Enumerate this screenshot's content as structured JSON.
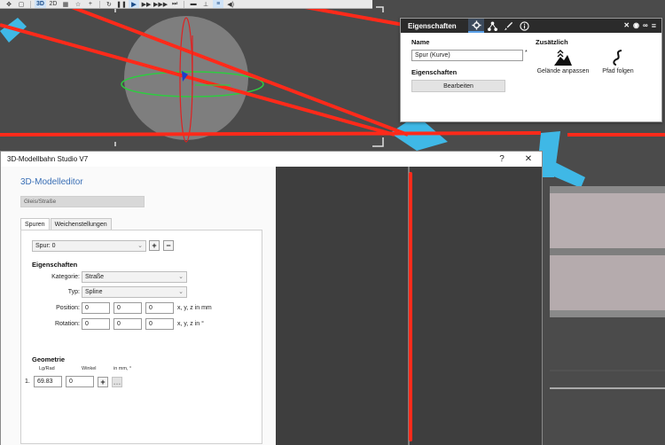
{
  "toolbar": {
    "items": [
      "3D",
      "2D"
    ]
  },
  "properties": {
    "title": "Eigenschaften",
    "name_label": "Name",
    "name_value": "Spur (Kurve)",
    "name_marker": "*",
    "props_label": "Eigenschaften",
    "edit_button": "Bearbeiten",
    "extra_label": "Zusätzlich",
    "terrain_label": "Gelände anpassen",
    "path_label": "Pfad folgen"
  },
  "window": {
    "title": "3D-Modellbahn Studio V7",
    "help": "?",
    "close": "✕"
  },
  "editor": {
    "title": "3D-Modelleditor",
    "category_field": "Gleis/Straße",
    "tabs": [
      "Spuren",
      "Weichenstellungen"
    ],
    "track_select": "Spur: 0",
    "add_symbol": "+",
    "remove_symbol": "−",
    "properties_heading": "Eigenschaften",
    "kategorie_label": "Kategorie:",
    "kategorie_value": "Straße",
    "typ_label": "Typ:",
    "typ_value": "Spline",
    "position_label": "Position:",
    "position": [
      "0",
      "0",
      "0"
    ],
    "position_unit": "x, y, z in mm",
    "rotation_label": "Rotation:",
    "rotation": [
      "0",
      "0",
      "0"
    ],
    "rotation_unit": "x, y, z in °",
    "geometry_heading": "Geometrie",
    "col_lg": "Lg/Rad",
    "col_winkel": "Winkel",
    "col_unit": "in mm, °",
    "row_index": "1.",
    "row_lg": "69.83",
    "row_winkel": "0",
    "row_add": "+",
    "row_more": "…"
  },
  "colors": {
    "accent": "#3a6fb5",
    "track_red": "#ff2a1a",
    "panel_header": "#2b2b2b",
    "viewport_bg": "#4b4b4b"
  }
}
